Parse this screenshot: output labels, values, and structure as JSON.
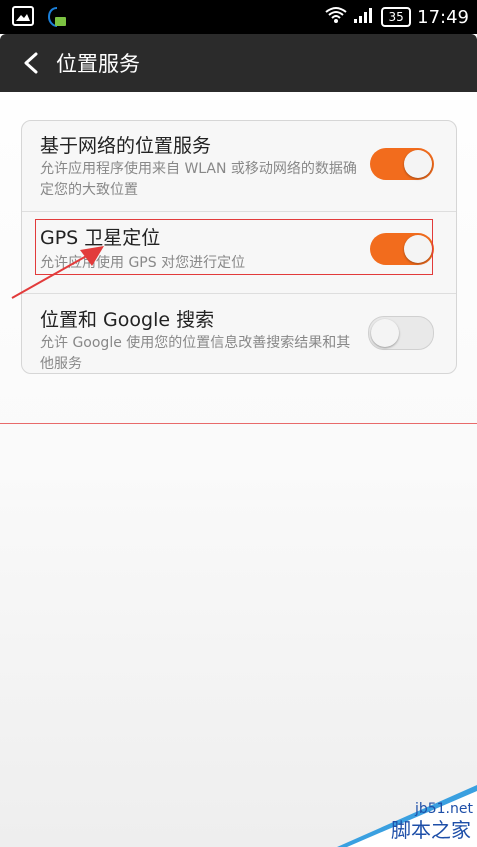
{
  "status_bar": {
    "battery": "35",
    "time": "17:49",
    "icons": [
      "image-notification-icon",
      "lock-app-icon",
      "wifi-icon",
      "signal-icon",
      "battery-icon"
    ]
  },
  "header": {
    "title": "位置服务",
    "back_icon": "chevron-left-icon"
  },
  "settings": [
    {
      "title": "基于网络的位置服务",
      "subtitle": "允许应用程序使用来自 WLAN 或移动网络的数据确定您的大致位置",
      "enabled": true
    },
    {
      "title": "GPS 卫星定位",
      "subtitle": "允许应用使用 GPS 对您进行定位",
      "enabled": true
    },
    {
      "title": "位置和 Google 搜索",
      "subtitle": "允许 Google 使用您的位置信息改善搜索结果和其他服务",
      "enabled": false
    }
  ],
  "colors": {
    "accent": "#f26c1d",
    "header_bg": "#2b2b2b",
    "annotation": "#e23b3b"
  },
  "watermark": {
    "url": "jb51.net",
    "name": "脚本之家"
  }
}
